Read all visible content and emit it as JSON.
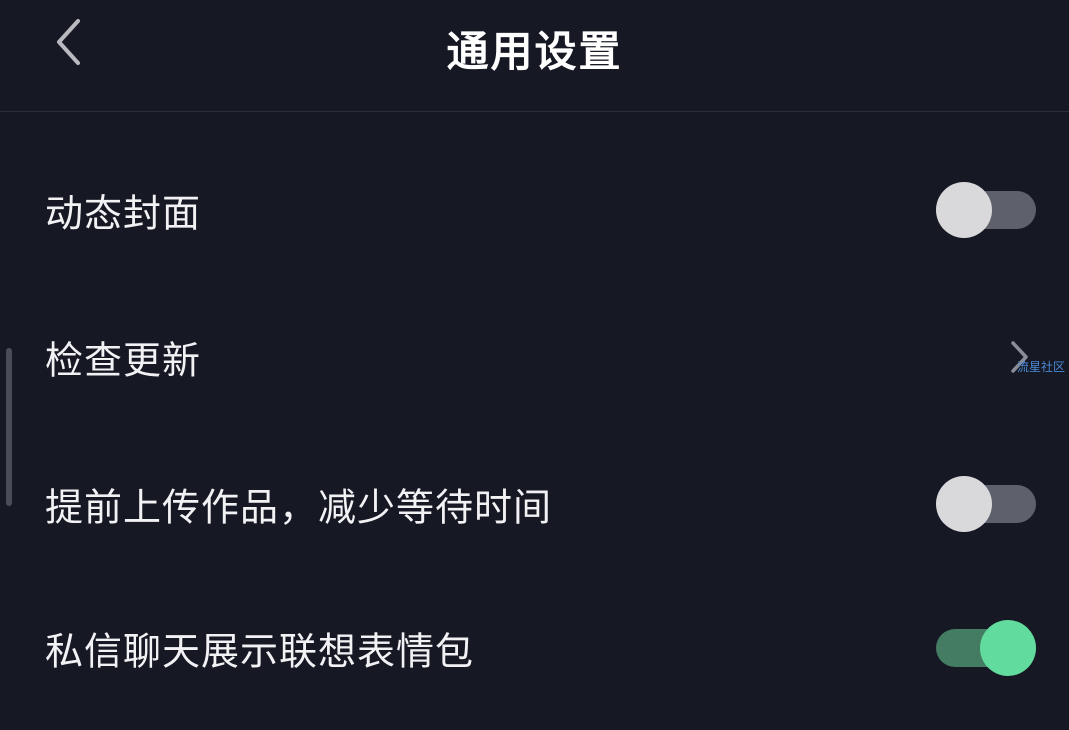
{
  "header": {
    "title": "通用设置",
    "back_icon": "chevron-left-icon"
  },
  "settings": [
    {
      "label": "动态封面",
      "control": "toggle",
      "state": "off"
    },
    {
      "label": "检查更新",
      "control": "chevron",
      "icon": "chevron-right-icon"
    },
    {
      "label": "提前上传作品，减少等待时间",
      "control": "toggle",
      "state": "off"
    },
    {
      "label": "私信聊天展示联想表情包",
      "control": "toggle",
      "state": "on"
    }
  ],
  "watermark": "流星社区",
  "colors": {
    "background": "#161824",
    "toggle_on_track": "#447b63",
    "toggle_on_knob": "#62dc9e",
    "toggle_off_track": "#5e606b",
    "toggle_off_knob": "#d9d9dc",
    "watermark": "#4a8ad6"
  }
}
